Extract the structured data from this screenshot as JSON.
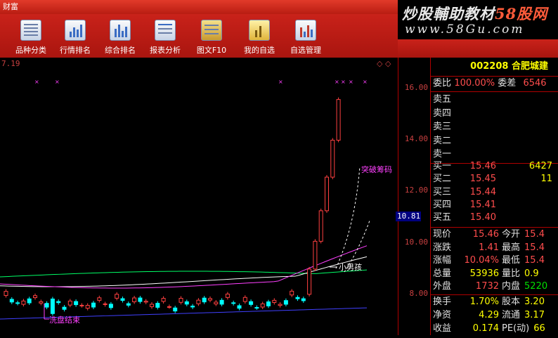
{
  "titlebar": {
    "title": "财富"
  },
  "toolbar": {
    "items": [
      {
        "label": "品种分类",
        "icon": "classify-icon"
      },
      {
        "label": "行情排名",
        "icon": "rank-icon"
      },
      {
        "label": "综合排名",
        "icon": "composite-rank-icon"
      },
      {
        "label": "报表分析",
        "icon": "report-icon"
      },
      {
        "label": "图文F10",
        "icon": "f10-icon"
      },
      {
        "label": "我的自选",
        "icon": "watchlist-icon"
      },
      {
        "label": "自选管理",
        "icon": "watchlist-manage-icon"
      }
    ]
  },
  "logo": {
    "line1_a": "炒股輔助教材",
    "line1_b": "58股网",
    "line2": "www.58Gu.com"
  },
  "chart_info": {
    "topleft": "7.19"
  },
  "annotations": {
    "breakout": "突破筹码",
    "boy": "小男孩",
    "washout": "洗盘结束"
  },
  "chart_data": {
    "type": "candlestick",
    "y_ticks": [
      "16.00",
      "14.00",
      "12.00",
      "10.00",
      "8.00"
    ],
    "ylim": [
      7.0,
      16.5
    ],
    "current_price": "10.81"
  },
  "quote": {
    "code": "002208",
    "name": "合肥城建",
    "weibi": {
      "label": "委比",
      "value": "100.00%",
      "label2": "委差",
      "value2": "6546"
    },
    "sells": [
      {
        "label": "卖五"
      },
      {
        "label": "卖四"
      },
      {
        "label": "卖三"
      },
      {
        "label": "卖二"
      },
      {
        "label": "卖一"
      }
    ],
    "buys": [
      {
        "label": "买一",
        "price": "15.46",
        "vol": "6427"
      },
      {
        "label": "买二",
        "price": "15.45",
        "vol": "11"
      },
      {
        "label": "买三",
        "price": "15.44",
        "vol": ""
      },
      {
        "label": "买四",
        "price": "15.41",
        "vol": ""
      },
      {
        "label": "买五",
        "price": "15.40",
        "vol": ""
      }
    ],
    "stats": [
      {
        "l1": "现价",
        "v1": "15.46",
        "l2": "今开",
        "v2": "15.4"
      },
      {
        "l1": "涨跌",
        "v1": "1.41",
        "l2": "最高",
        "v2": "15.4"
      },
      {
        "l1": "涨幅",
        "v1": "10.04%",
        "l2": "最低",
        "v2": "15.4"
      },
      {
        "l1": "总量",
        "v1": "53936",
        "l2": "量比",
        "v2": "0.9"
      },
      {
        "l1": "外盘",
        "v1": "1732",
        "l2": "内盘",
        "v2": "5220"
      }
    ],
    "stats2": [
      {
        "l1": "换手",
        "v1": "1.70%",
        "l2": "股本",
        "v2": "3.20"
      },
      {
        "l1": "净资",
        "v1": "4.29",
        "l2": "流通",
        "v2": "3.17"
      },
      {
        "l1": "收益",
        "v1": "0.174",
        "l2": "PE(动)",
        "v2": "66"
      }
    ]
  }
}
